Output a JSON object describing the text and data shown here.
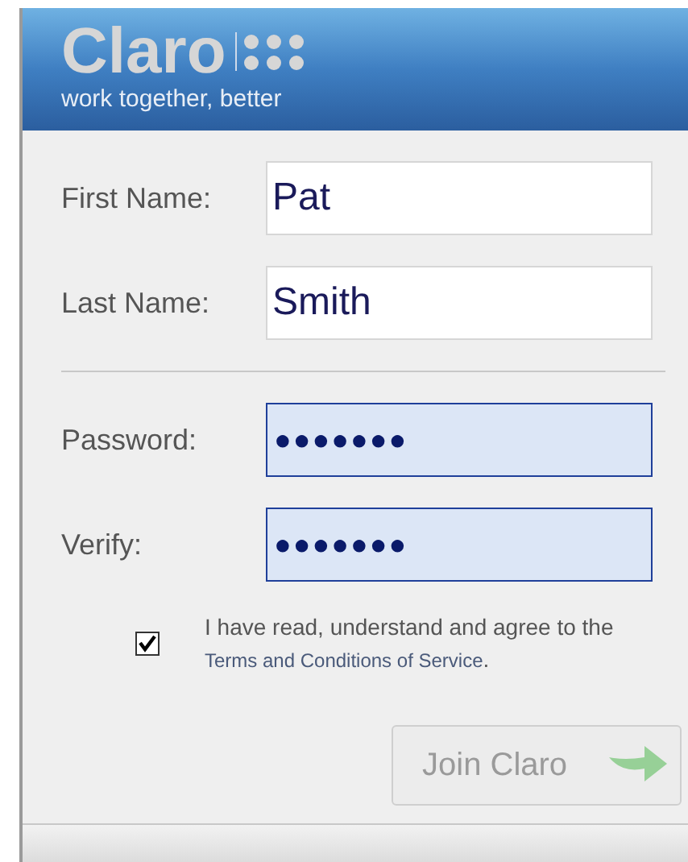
{
  "header": {
    "logo": "Claro",
    "tagline": "work together, better"
  },
  "fields": [
    {
      "label": "First Name:",
      "value": "Pat",
      "kind": "text"
    },
    {
      "label": "Last Name:",
      "value": "Smith",
      "kind": "text"
    },
    {
      "label": "Password:",
      "value": "●●●●●●●",
      "kind": "password"
    },
    {
      "label": "Verify:",
      "value": "●●●●●●●",
      "kind": "password"
    }
  ],
  "agreement": {
    "checked": true,
    "text": "I have read, understand and agree to the",
    "link": "Terms and Conditions of Service",
    "end": "."
  },
  "join_button": {
    "label": "Join Claro",
    "disabled": true
  }
}
